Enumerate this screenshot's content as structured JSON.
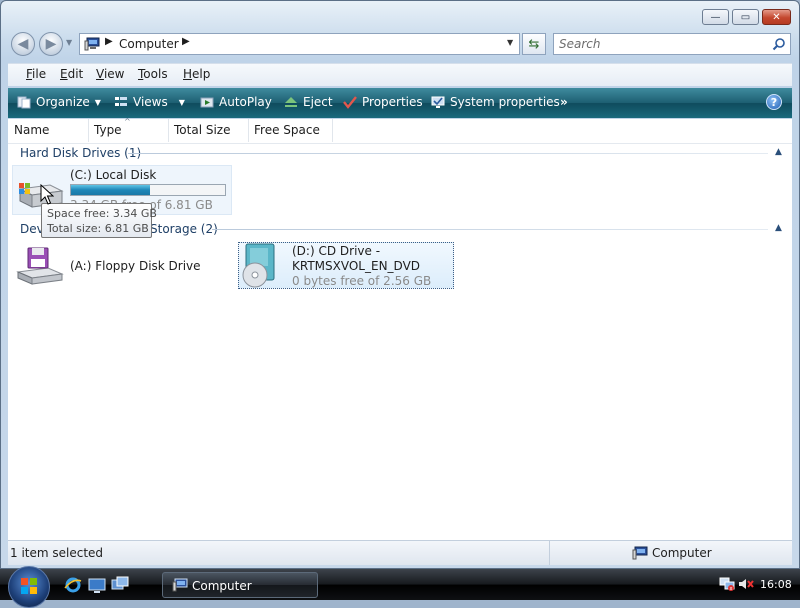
{
  "window": {
    "caption_buttons": {
      "minimize": "—",
      "maximize": "▭",
      "close": "✕"
    }
  },
  "nav": {
    "address_crumbs": [
      "Computer"
    ],
    "search_placeholder": "Search"
  },
  "menu": {
    "items": [
      {
        "first": "F",
        "rest": "ile"
      },
      {
        "first": "E",
        "rest": "dit"
      },
      {
        "first": "V",
        "rest": "iew"
      },
      {
        "first": "T",
        "rest": "ools"
      },
      {
        "first": "H",
        "rest": "elp"
      }
    ]
  },
  "commands": {
    "organize": "Organize",
    "views": "Views",
    "autoplay": "AutoPlay",
    "eject": "Eject",
    "properties": "Properties",
    "system_properties": "System properties",
    "more": "»",
    "help": "?"
  },
  "columns": [
    "Name",
    "Type",
    "Total Size",
    "Free Space"
  ],
  "groups": {
    "hard_disk": {
      "title": "Hard Disk Drives (1)",
      "drive": {
        "label": "(C:) Local Disk",
        "sub": "3.34 GB free of 6.81 GB",
        "used_fraction": 0.51
      }
    },
    "removable": {
      "title_left": "Dev",
      "title_right": "Storage (2)",
      "floppy": {
        "label": "(A:) Floppy Disk Drive"
      },
      "cd": {
        "label_line1": "(D:) CD Drive -",
        "label_line2": "KRTMSXVOL_EN_DVD",
        "sub": "0 bytes free of 2.56 GB"
      }
    }
  },
  "tooltip": {
    "line1": "Space free: 3.34 GB",
    "line2": "Total size: 6.81 GB"
  },
  "status": {
    "left": "1 item selected",
    "right": "Computer"
  },
  "taskbar": {
    "task_label": "Computer",
    "clock": "16:08"
  }
}
